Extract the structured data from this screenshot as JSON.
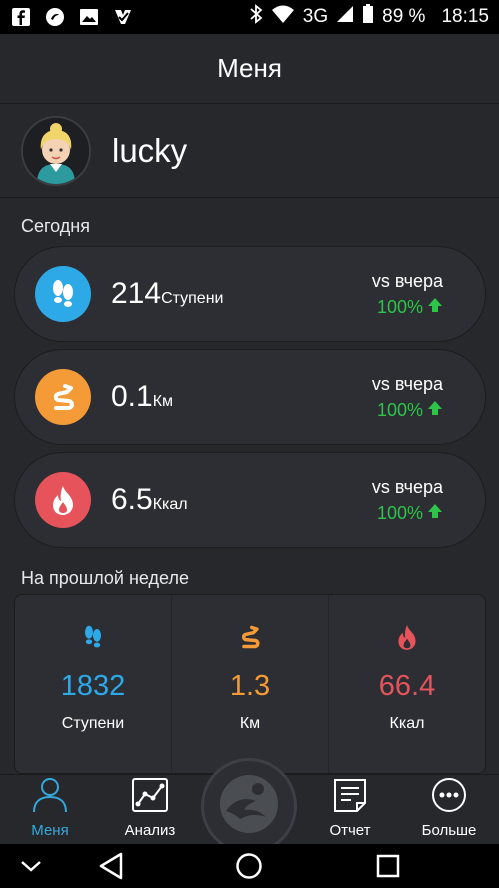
{
  "status_bar": {
    "left_icons": [
      "facebook-icon",
      "app-icon",
      "gallery-icon",
      "check-app-icon"
    ],
    "network": "3G",
    "battery": "89 %",
    "time": "18:15"
  },
  "header": {
    "title": "Меня"
  },
  "profile": {
    "name": "lucky"
  },
  "today": {
    "title": "Сегодня",
    "stats": [
      {
        "value": "214",
        "unit": "Ступени",
        "compare_label": "vs вчера",
        "compare_value": "100%",
        "icon": "footsteps-icon",
        "color": "#2ea9e8"
      },
      {
        "value": "0.1",
        "unit": "Км",
        "compare_label": "vs вчера",
        "compare_value": "100%",
        "icon": "route-icon",
        "color": "#f49a37"
      },
      {
        "value": "6.5",
        "unit": "Ккал",
        "compare_label": "vs вчера",
        "compare_value": "100%",
        "icon": "flame-icon",
        "color": "#e6535b"
      }
    ]
  },
  "last_week": {
    "title": "На прошлой неделе",
    "items": [
      {
        "value": "1832",
        "unit": "Ступени",
        "color": "#2ea9e8",
        "icon": "footsteps-icon"
      },
      {
        "value": "1.3",
        "unit": "Км",
        "color": "#f49a37",
        "icon": "route-icon"
      },
      {
        "value": "66.4",
        "unit": "Ккал",
        "color": "#e6535b",
        "icon": "flame-icon"
      }
    ]
  },
  "bottom_nav": {
    "items": [
      {
        "label": "Меня",
        "active": true,
        "icon": "person-icon"
      },
      {
        "label": "Анализ",
        "active": false,
        "icon": "chart-icon"
      },
      {
        "label": "Отчет",
        "active": false,
        "icon": "report-icon"
      },
      {
        "label": "Больше",
        "active": false,
        "icon": "more-icon"
      }
    ],
    "center_icon": "run-icon"
  },
  "colors": {
    "green": "#2ec44a",
    "accent_active": "#35a9de",
    "background": "#26282c",
    "card": "#2c2e33"
  }
}
